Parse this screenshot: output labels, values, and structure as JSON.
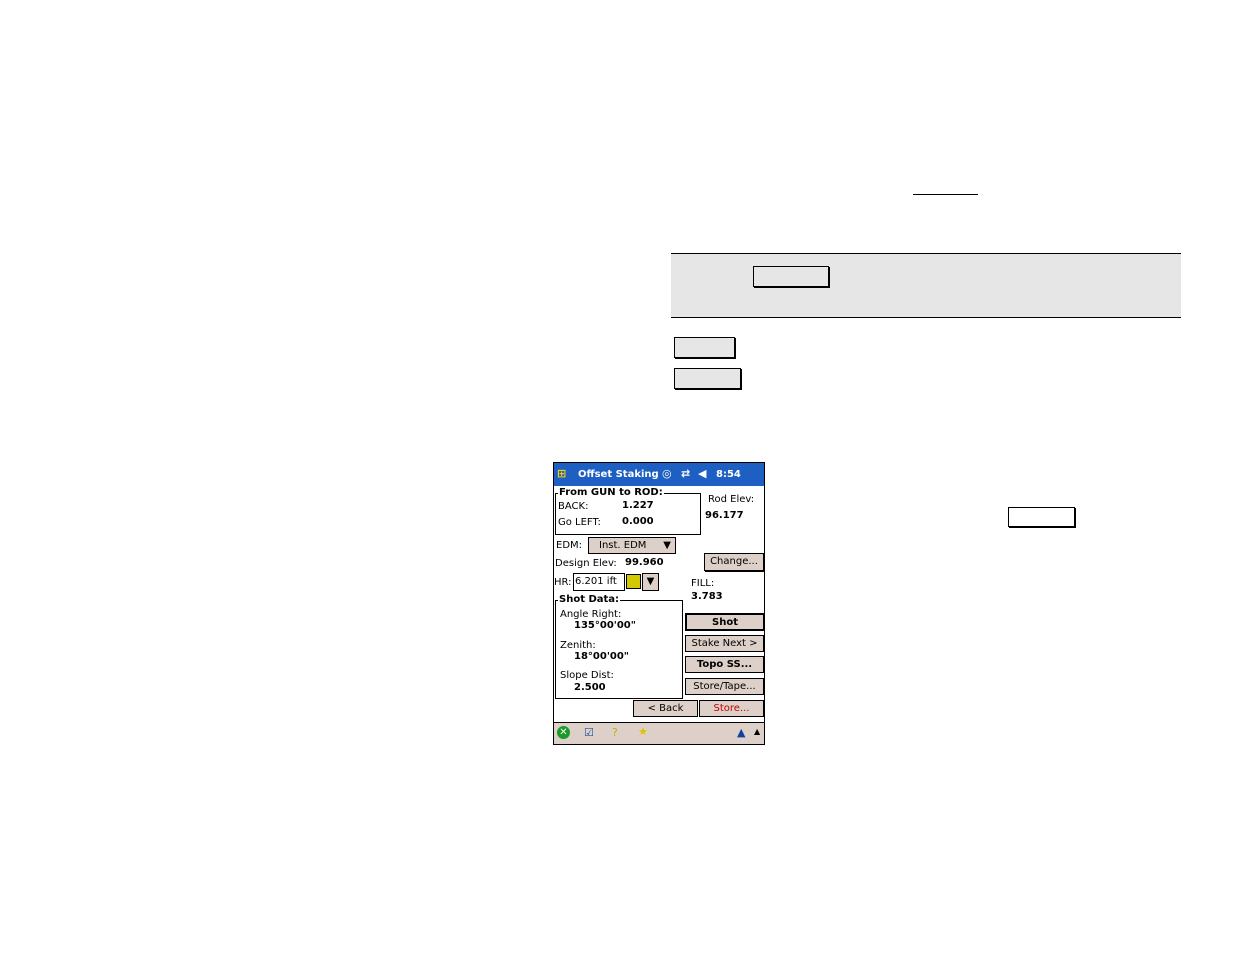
{
  "device": {
    "title": "Offset Staking",
    "time": "8:54",
    "from_group": "From GUN to ROD:",
    "back_label": "BACK:",
    "back_value": "1.227",
    "left_label": "Go LEFT:",
    "left_value": "0.000",
    "rod_elev_label": "Rod Elev:",
    "rod_elev_value": "96.177",
    "edm_label": "EDM:",
    "edm_value": "Inst. EDM",
    "design_elev_label": "Design Elev:",
    "design_elev_value": "99.960",
    "change_button": "Change...",
    "hr_label": "HR:",
    "hr_value": "6.201 ift",
    "fill_label": "FILL:",
    "fill_value": "3.783",
    "shot_group": "Shot Data:",
    "angle_right_label": "Angle Right:",
    "angle_right_value": "135°00'00\"",
    "zenith_label": "Zenith:",
    "zenith_value": "18°00'00\"",
    "slope_dist_label": "Slope Dist:",
    "slope_dist_value": "2.500",
    "buttons": {
      "shot": "Shot",
      "stake_next": "Stake Next >",
      "topo": "Topo SS...",
      "store_tape": "Store/Tape...",
      "back": "< Back",
      "store": "Store..."
    },
    "colors": {
      "title_bar": "#1d5fc2",
      "button": "#dcd0c8",
      "store_text": "#c00000"
    }
  }
}
